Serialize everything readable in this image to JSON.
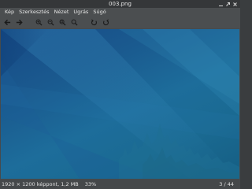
{
  "window": {
    "title": "003.png"
  },
  "menu": {
    "items": [
      "Kép",
      "Szerkesztés",
      "Nézet",
      "Ugrás",
      "Súgó"
    ]
  },
  "toolbar": {
    "buttons": [
      {
        "icon": "arrow-left-icon"
      },
      {
        "icon": "arrow-right-icon"
      },
      {
        "icon": "zoom-in-icon"
      },
      {
        "icon": "zoom-out-icon"
      },
      {
        "icon": "zoom-fit-icon"
      },
      {
        "icon": "zoom-original-icon"
      },
      {
        "icon": "rotate-left-icon"
      },
      {
        "icon": "rotate-right-icon"
      }
    ]
  },
  "status": {
    "info": "1920 × 1200 képpont,  1,2 MB",
    "zoom": "33%",
    "page": "3 / 44"
  },
  "colors": {
    "image_top": "#174a86",
    "image_bottom": "#155e83"
  }
}
